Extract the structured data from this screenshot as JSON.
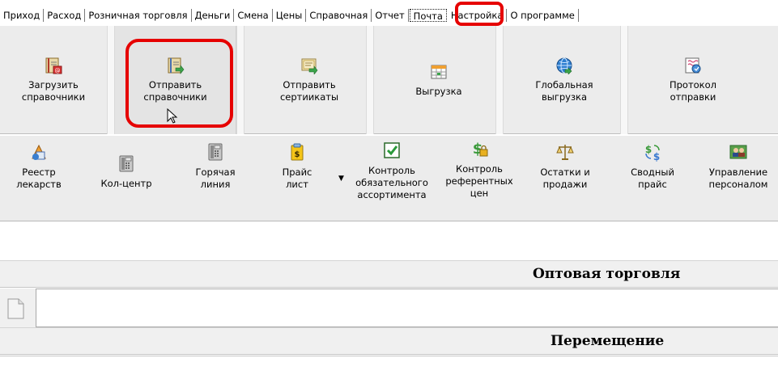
{
  "menu": {
    "items": [
      "Приход",
      "Расход",
      "Розничная торговля",
      "Деньги",
      "Смена",
      "Цены",
      "Справочная",
      "Отчет",
      "Почта",
      "Настройка",
      "О программе"
    ],
    "active": "Почта"
  },
  "ribbon_top": {
    "buttons": [
      {
        "line1": "Загрузить",
        "line2": "справочники",
        "icon": "book-envelope-icon"
      },
      {
        "line1": "Отправить",
        "line2": "справочники",
        "icon": "book-arrow-icon",
        "selected": true
      },
      {
        "line1": "Отправить",
        "line2": "сертиикаты",
        "icon": "certificate-icon"
      },
      {
        "line1": "Выгрузка",
        "line2": "",
        "icon": "table-export-icon"
      },
      {
        "line1": "Глобальная",
        "line2": "выгрузка",
        "icon": "globe-icon"
      },
      {
        "line1": "Протокол",
        "line2": "отправки",
        "icon": "protocol-icon"
      }
    ]
  },
  "ribbon_bottom": {
    "buttons": [
      {
        "line1": "Реестр",
        "line2": "лекарств",
        "line3": "",
        "icon": "medicine-registry-icon"
      },
      {
        "line1": "Кол-центр",
        "line2": "",
        "line3": "",
        "icon": "call-center-phone-icon"
      },
      {
        "line1": "Горячая",
        "line2": "линия",
        "line3": "",
        "icon": "hotline-phone-icon"
      },
      {
        "line1": "Прайс",
        "line2": "лист",
        "line3": "",
        "icon": "price-list-icon"
      },
      {
        "line1": "Контроль",
        "line2": "обязательного",
        "line3": "ассортимента",
        "icon": "checkbox-icon"
      },
      {
        "line1": "Контроль",
        "line2": "референтных",
        "line3": "цен",
        "icon": "dollar-lock-icon"
      },
      {
        "line1": "Остатки и",
        "line2": "продажи",
        "line3": "",
        "icon": "scales-icon"
      },
      {
        "line1": "Сводный",
        "line2": "прайс",
        "line3": "",
        "icon": "currency-exchange-icon"
      },
      {
        "line1": "Управление",
        "line2": "персоналом",
        "line3": "",
        "icon": "staff-icon"
      }
    ],
    "dropdown_glyph": "▼"
  },
  "sections": {
    "wholesale": "Оптовая торговля",
    "transfer": "Перемещение"
  },
  "colors": {
    "highlight": "#e60000",
    "ribbon_bg": "#ececec"
  }
}
